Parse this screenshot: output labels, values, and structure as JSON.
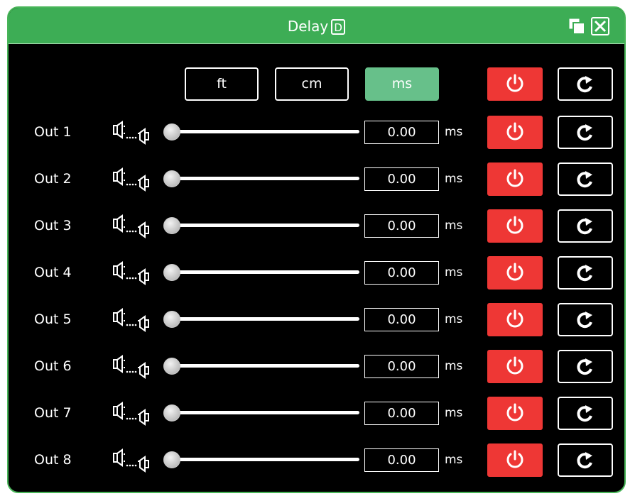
{
  "window": {
    "title": "Delay",
    "title_badge": "D",
    "accent_color": "#3dad55",
    "restore_icon": "restore-window-icon",
    "close_icon": "close-icon"
  },
  "units": {
    "buttons": [
      {
        "label": "ft",
        "active": false
      },
      {
        "label": "cm",
        "active": false
      },
      {
        "label": "ms",
        "active": true
      }
    ],
    "active_color": "#67c08a"
  },
  "master": {
    "power_icon": "power-icon",
    "reset_icon": "refresh-icon",
    "power_color": "#ee3735"
  },
  "outputs": [
    {
      "label": "Out 1",
      "value": "0.00",
      "unit": "ms",
      "slider_fraction": 0
    },
    {
      "label": "Out 2",
      "value": "0.00",
      "unit": "ms",
      "slider_fraction": 0
    },
    {
      "label": "Out 3",
      "value": "0.00",
      "unit": "ms",
      "slider_fraction": 0
    },
    {
      "label": "Out 4",
      "value": "0.00",
      "unit": "ms",
      "slider_fraction": 0
    },
    {
      "label": "Out 5",
      "value": "0.00",
      "unit": "ms",
      "slider_fraction": 0
    },
    {
      "label": "Out 6",
      "value": "0.00",
      "unit": "ms",
      "slider_fraction": 0
    },
    {
      "label": "Out 7",
      "value": "0.00",
      "unit": "ms",
      "slider_fraction": 0
    },
    {
      "label": "Out 8",
      "value": "0.00",
      "unit": "ms",
      "slider_fraction": 0
    }
  ]
}
